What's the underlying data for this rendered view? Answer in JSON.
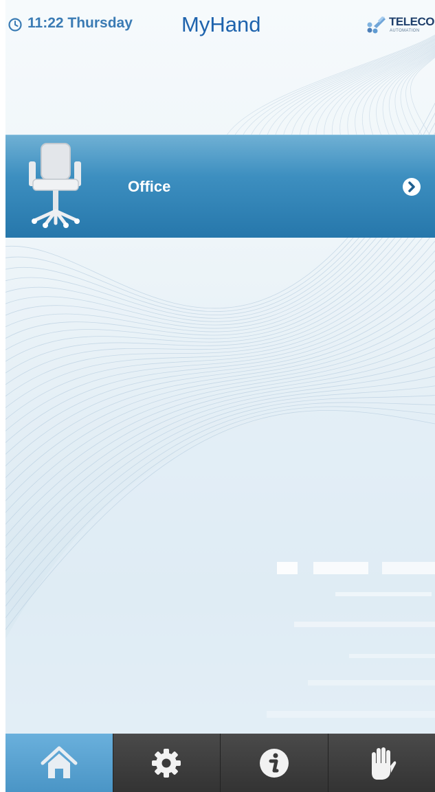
{
  "status_bar": {
    "time": "11:22 Thursday",
    "app_name": "MyHand",
    "brand_name": "TELECO",
    "brand_subtitle": "AUTOMATION",
    "clock_icon": "clock-icon"
  },
  "rooms": [
    {
      "label": "Office",
      "icon": "office-chair-icon",
      "arrow_icon": "chevron-right-circle-icon"
    }
  ],
  "bottom_nav": {
    "items": [
      {
        "name": "home",
        "icon": "home-icon",
        "active": true
      },
      {
        "name": "settings",
        "icon": "gear-icon",
        "active": false
      },
      {
        "name": "info",
        "icon": "info-icon",
        "active": false
      },
      {
        "name": "hand",
        "icon": "hand-icon",
        "active": false
      }
    ]
  },
  "colors": {
    "accent": "#3a7bb4",
    "room_bar": "#2e82b8",
    "nav_active": "#5aa2d0",
    "nav_bg": "#3a3a3a"
  }
}
